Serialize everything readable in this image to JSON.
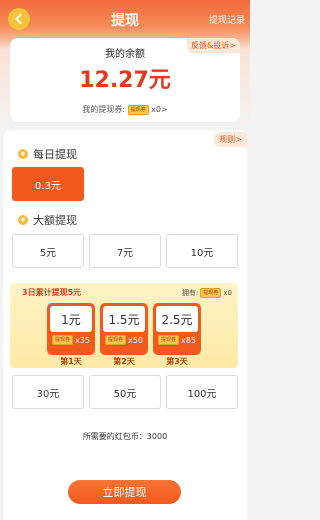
{
  "header": {
    "title": "提现",
    "records_label": "提现记录"
  },
  "balance": {
    "feedback_label": "反馈&投诉>",
    "label": "我的余额",
    "value": "12.27元",
    "voucher_prefix": "我的提现券:",
    "voucher_count": "x0>",
    "ticket_text": "提现券"
  },
  "panel": {
    "rules_label": "规则>",
    "daily_title": "每日提现",
    "daily_options": [
      "0.3元"
    ],
    "large_title": "大额提现",
    "large_options_row1": [
      "5元",
      "7元",
      "10元"
    ],
    "large_options_row2": [
      "30元",
      "50元",
      "100元"
    ]
  },
  "cumulative": {
    "title": "3日累计提现5元",
    "owned_label": "拥有:",
    "owned_count": "x0",
    "days": [
      {
        "amount": "1元",
        "count": "x35",
        "label": "第1天"
      },
      {
        "amount": "1.5元",
        "count": "x50",
        "label": "第2天"
      },
      {
        "amount": "2.5元",
        "count": "x85",
        "label": "第3天"
      }
    ]
  },
  "footer": {
    "need_line": "所需要的红包币：3000",
    "withdraw_label": "立即提现"
  },
  "colors": {
    "accent": "#f25a1d",
    "balance_red": "#e2391e",
    "coin": "#f6b93b"
  }
}
